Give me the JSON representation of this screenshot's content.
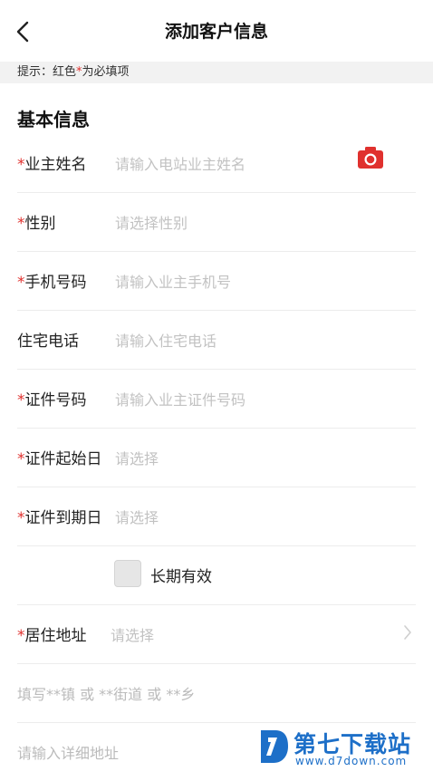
{
  "header": {
    "title": "添加客户信息"
  },
  "hint": {
    "prefix": "提示：红色",
    "star": "*",
    "suffix": "为必填项"
  },
  "section": {
    "title": "基本信息"
  },
  "fields": [
    {
      "label": "业主姓名",
      "required": "*",
      "placeholder": "请输入电站业主姓名"
    },
    {
      "label": "性别",
      "required": "*",
      "placeholder": "请选择性别"
    },
    {
      "label": "手机号码",
      "required": "*",
      "placeholder": "请输入业主手机号"
    },
    {
      "label": "住宅电话",
      "required": "",
      "placeholder": "请输入住宅电话"
    },
    {
      "label": "证件号码",
      "required": "*",
      "placeholder": "请输入业主证件号码"
    },
    {
      "label": "证件起始日",
      "required": "*",
      "placeholder": "请选择"
    },
    {
      "label": "证件到期日",
      "required": "*",
      "placeholder": "请选择"
    }
  ],
  "long_term": {
    "label": "长期有效",
    "checked": false
  },
  "address": {
    "label": "居住地址",
    "required": "*",
    "placeholder": "请选择"
  },
  "town_placeholder": "填写**镇 或 **街道 或 **乡",
  "detail_placeholder": "请输入详细地址",
  "watermark": {
    "name": "第七下载站",
    "url": "www.d7down.com"
  },
  "colors": {
    "required": "#e0312e",
    "camera": "#e0312e",
    "watermark": "#1d6fc8"
  },
  "icons": {
    "back": "chevron-left-icon",
    "camera": "camera-icon",
    "arrow": "chevron-right-icon"
  }
}
